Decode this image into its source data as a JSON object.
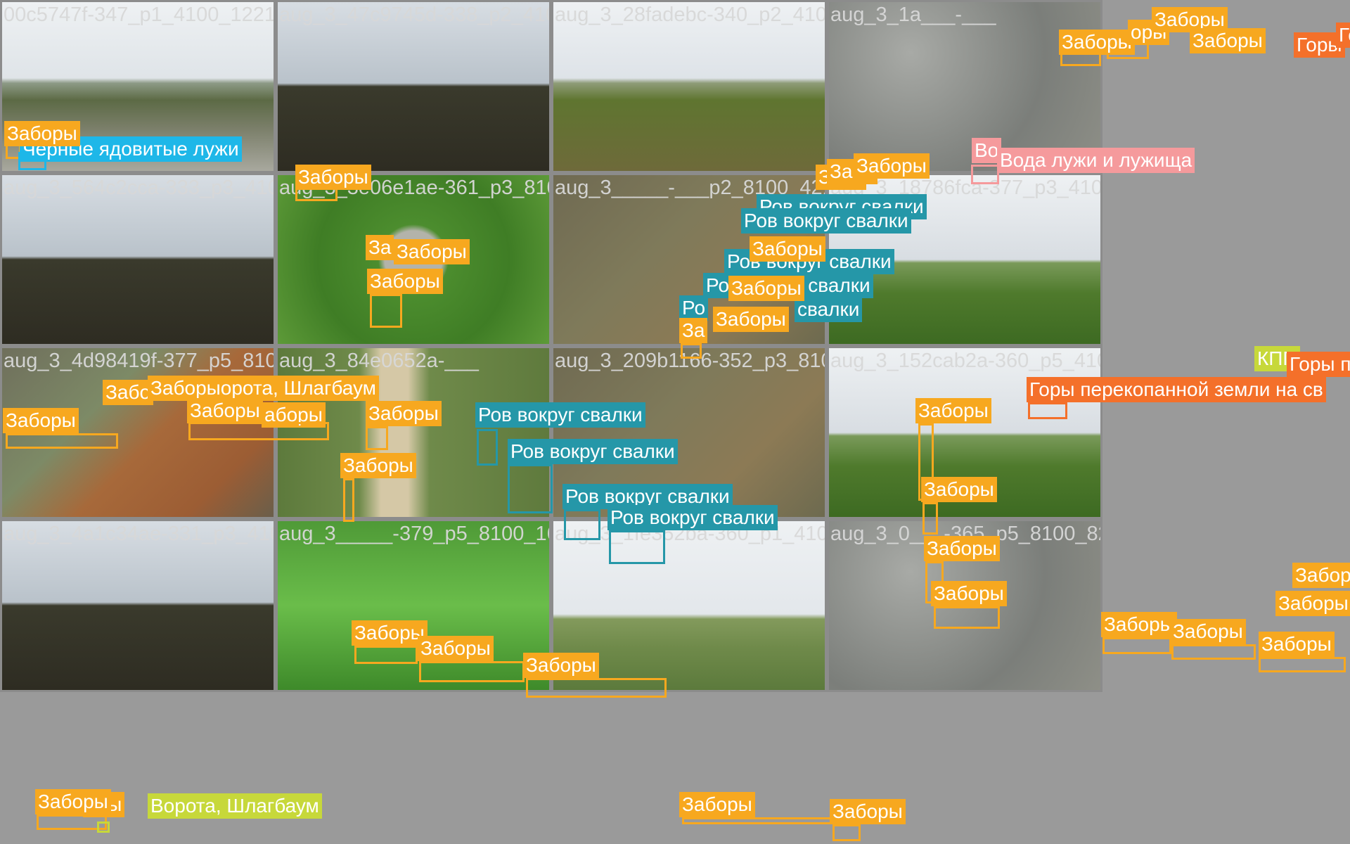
{
  "tiles": [
    {
      "filename": "00c5747f-347_p1_4100_12210.jpg",
      "scene": "sky-forest"
    },
    {
      "filename": "aug_3_47c9745d-338_p2_4100_8210.jpg",
      "scene": "dark-forest"
    },
    {
      "filename": "aug_3_28fadebc-340_p2_4100_4210.jpg",
      "scene": "field"
    },
    {
      "filename": "aug_3_1a___-___",
      "scene": "trash"
    },
    {
      "filename": "aug_3_564c2cca-333_p3_4100_8210.jpg",
      "scene": "dark-forest"
    },
    {
      "filename": "aug_3_3e06e1ae-361_p3_8100_4210.jpg",
      "scene": "green-aerial"
    },
    {
      "filename": "aug_3_____-___p2_8100_4210.jpg",
      "scene": "mud"
    },
    {
      "filename": "aug_3_18786fca-377_p3_4100_20",
      "scene": "fields-wide"
    },
    {
      "filename": "aug_3_4d98419f-377_p5_8100_4210.jpg",
      "scene": "redclay"
    },
    {
      "filename": "aug_3_84e0652a-___",
      "scene": "road-aerial"
    },
    {
      "filename": "aug_3_209b1166-352_p3_8100_8210.jpg",
      "scene": "mud"
    },
    {
      "filename": "aug_3_152cab2a-360_p5_4100_21",
      "scene": "fields-wide"
    },
    {
      "filename": "aug_3_4a1c34ae-331_p3_4100_8210.jpg",
      "scene": "dark-forest"
    },
    {
      "filename": "aug_3_____-379_p5_8100_1621",
      "scene": "lush"
    },
    {
      "filename": "aug_3_1fe352ba-360_p1_4100_12210.jpg",
      "scene": "farmland"
    },
    {
      "filename": "aug_3_0___-365_p5_8100_82",
      "scene": "trash"
    }
  ],
  "labels": {
    "fences": "Заборы",
    "black_puddles": "Черные ядовитые лужи",
    "water_puddles": "Вода лужи и лужища",
    "ditch": "Ров вокруг свалки",
    "gate": "Ворота, Шлагбаум",
    "dug_earth": "Горы перекопанной земли на св",
    "kpp": "КПП",
    "mountains_short": "Горы",
    "water_short": "Во",
    "fences_partial_1": "Забо",
    "fences_partial_2": "За",
    "fences_partial_3": "аборы",
    "fences_partial_4": "оры",
    "fences_partial_5": "Заборыорота, Шлагбаум",
    "ditch_partial_1": "Ро",
    "ditch_partial_2": "Ров вокруг свалки",
    "ditch_partial_3": "свалки"
  },
  "colors": {
    "fences": "#f7a81f",
    "black_puddles": "#1eb7e8",
    "ditch": "#2597a8",
    "water_puddles": "#f59a9c",
    "dug_earth": "#f4702a",
    "gate": "#c7d83a"
  }
}
